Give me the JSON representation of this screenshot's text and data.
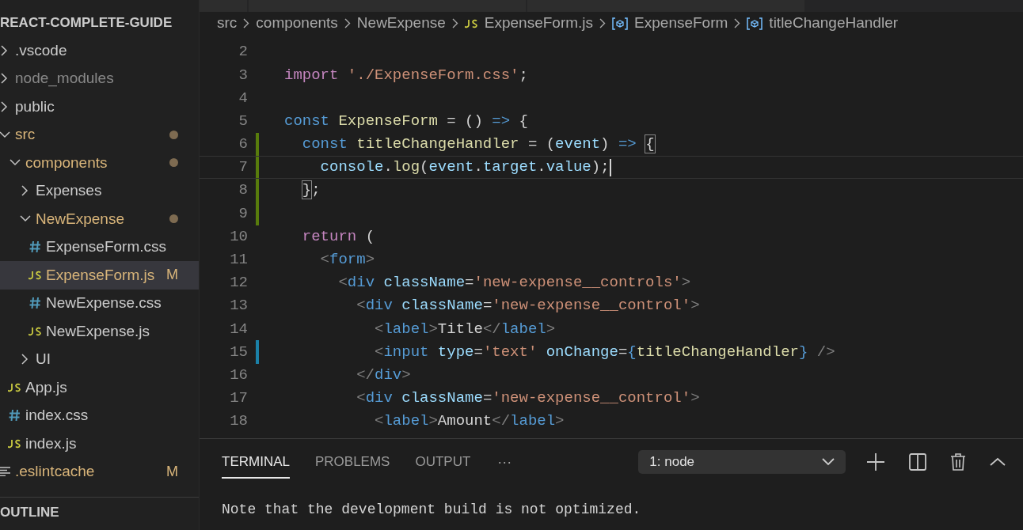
{
  "explorer": {
    "title": "REACT-COMPLETE-GUIDE",
    "items": [
      {
        "name": ".vscode",
        "kind": "folder",
        "expanded": false,
        "modified": false,
        "dimmed": false,
        "modified_dot": false,
        "selected": false
      },
      {
        "name": "node_modules",
        "kind": "folder",
        "expanded": false,
        "modified": false,
        "dimmed": true,
        "modified_dot": false,
        "selected": false
      },
      {
        "name": "public",
        "kind": "folder",
        "expanded": false,
        "modified": false,
        "dimmed": false,
        "modified_dot": false,
        "selected": false
      },
      {
        "name": "src",
        "kind": "folder",
        "expanded": true,
        "modified": true,
        "dimmed": false,
        "modified_dot": true,
        "selected": false,
        "children": [
          {
            "name": "components",
            "kind": "folder",
            "expanded": true,
            "modified": true,
            "dimmed": false,
            "modified_dot": true,
            "selected": false,
            "children": [
              {
                "name": "Expenses",
                "kind": "folder",
                "expanded": false,
                "modified": false,
                "dimmed": false,
                "modified_dot": false,
                "selected": false
              },
              {
                "name": "NewExpense",
                "kind": "folder",
                "expanded": true,
                "modified": true,
                "dimmed": false,
                "modified_dot": true,
                "selected": false,
                "children": [
                  {
                    "name": "ExpenseForm.css",
                    "kind": "css",
                    "modified": false,
                    "dimmed": false,
                    "modified_dot": false,
                    "selected": false
                  },
                  {
                    "name": "ExpenseForm.js",
                    "kind": "js",
                    "modified": true,
                    "dimmed": false,
                    "modified_dot": false,
                    "badge": "M",
                    "selected": true
                  },
                  {
                    "name": "NewExpense.css",
                    "kind": "css",
                    "modified": false,
                    "dimmed": false,
                    "modified_dot": false,
                    "selected": false
                  },
                  {
                    "name": "NewExpense.js",
                    "kind": "js",
                    "modified": false,
                    "dimmed": false,
                    "modified_dot": false,
                    "selected": false
                  }
                ]
              },
              {
                "name": "UI",
                "kind": "folder",
                "expanded": false,
                "modified": false,
                "dimmed": false,
                "modified_dot": false,
                "selected": false
              }
            ]
          },
          {
            "name": "App.js",
            "kind": "js",
            "modified": false,
            "dimmed": false,
            "modified_dot": false,
            "selected": false
          },
          {
            "name": "index.css",
            "kind": "css",
            "modified": false,
            "dimmed": false,
            "modified_dot": false,
            "selected": false
          },
          {
            "name": "index.js",
            "kind": "js",
            "modified": false,
            "dimmed": false,
            "modified_dot": false,
            "selected": false
          }
        ]
      },
      {
        "name": ".eslintcache",
        "kind": "text",
        "modified": true,
        "dimmed": false,
        "modified_dot": false,
        "badge": "M",
        "selected": false
      }
    ],
    "outline_title": "OUTLINE"
  },
  "breadcrumbs": [
    {
      "label": "src",
      "kind": "folder"
    },
    {
      "label": "components",
      "kind": "folder"
    },
    {
      "label": "NewExpense",
      "kind": "folder"
    },
    {
      "label": "ExpenseForm.js",
      "kind": "js"
    },
    {
      "label": "ExpenseForm",
      "kind": "symbol"
    },
    {
      "label": "titleChangeHandler",
      "kind": "symbol"
    }
  ],
  "editor": {
    "lines": [
      {
        "number": "2",
        "added": false,
        "modified": false,
        "current": false,
        "bracket_match": false
      },
      {
        "number": "3",
        "added": false,
        "modified": false,
        "current": false,
        "bracket_match": false,
        "code": "import './ExpenseForm.css';"
      },
      {
        "number": "4",
        "added": false,
        "modified": false,
        "current": false,
        "bracket_match": false
      },
      {
        "number": "5",
        "added": false,
        "modified": false,
        "current": false,
        "bracket_match": false,
        "code": "const ExpenseForm = () => {"
      },
      {
        "number": "6",
        "added": true,
        "modified": false,
        "current": false,
        "bracket_match": true,
        "code": "  const titleChangeHandler = (event) => {"
      },
      {
        "number": "7",
        "added": true,
        "modified": false,
        "current": true,
        "bracket_match": false,
        "code": "    console.log(event.target.value);"
      },
      {
        "number": "8",
        "added": true,
        "modified": false,
        "current": false,
        "bracket_match": true,
        "code": "  };"
      },
      {
        "number": "9",
        "added": true,
        "modified": false,
        "current": false,
        "bracket_match": false
      },
      {
        "number": "10",
        "added": false,
        "modified": false,
        "current": false,
        "bracket_match": false,
        "code": "  return ("
      },
      {
        "number": "11",
        "added": false,
        "modified": false,
        "current": false,
        "bracket_match": false,
        "code": "    <form>"
      },
      {
        "number": "12",
        "added": false,
        "modified": false,
        "current": false,
        "bracket_match": false,
        "code": "      <div className='new-expense__controls'>"
      },
      {
        "number": "13",
        "added": false,
        "modified": false,
        "current": false,
        "bracket_match": false,
        "code": "        <div className='new-expense__control'>"
      },
      {
        "number": "14",
        "added": false,
        "modified": false,
        "current": false,
        "bracket_match": false,
        "code": "          <label>Title</label>"
      },
      {
        "number": "15",
        "added": false,
        "modified": true,
        "current": false,
        "bracket_match": false,
        "code": "          <input type='text' onChange={titleChangeHandler} />"
      },
      {
        "number": "16",
        "added": false,
        "modified": false,
        "current": false,
        "bracket_match": false,
        "code": "        </div>"
      },
      {
        "number": "17",
        "added": false,
        "modified": false,
        "current": false,
        "bracket_match": false,
        "code": "        <div className='new-expense__control'>"
      },
      {
        "number": "18",
        "added": false,
        "modified": false,
        "current": false,
        "bracket_match": false,
        "code": "          <label>Amount</label>"
      }
    ]
  },
  "panel": {
    "tabs": [
      {
        "label": "TERMINAL",
        "selected": true
      },
      {
        "label": "PROBLEMS",
        "selected": false
      },
      {
        "label": "OUTPUT",
        "selected": false
      }
    ],
    "more": "···",
    "terminal_select": "1: node",
    "output": [
      "Note that the development build is not optimized."
    ]
  }
}
